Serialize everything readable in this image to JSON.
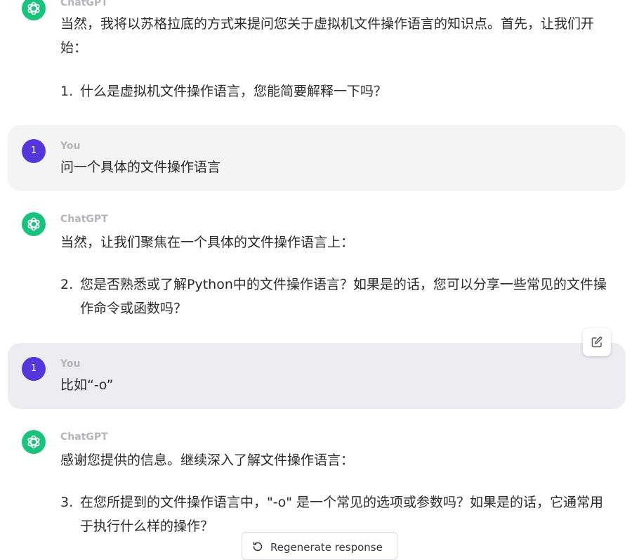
{
  "conversation": {
    "msg1": {
      "author": "ChatGPT",
      "text": "当然，我将以苏格拉底的方式来提问您关于虚拟机文件操作语言的知识点。首先，让我们开始：",
      "item_num": "1.",
      "item_text": "什么是虚拟机文件操作语言，您能简要解释一下吗？"
    },
    "msg2": {
      "author": "You",
      "avatar_letter": "1",
      "text": "问一个具体的文件操作语言"
    },
    "msg3": {
      "author": "ChatGPT",
      "text": "当然，让我们聚焦在一个具体的文件操作语言上：",
      "item_num": "2.",
      "item_text": "您是否熟悉或了解Python中的文件操作语言？如果是的话，您可以分享一些常见的文件操作命令或函数吗？"
    },
    "msg4": {
      "author": "You",
      "avatar_letter": "1",
      "text": "比如“-o”"
    },
    "msg5": {
      "author": "ChatGPT",
      "text": "感谢您提供的信息。继续深入了解文件操作语言：",
      "item_num": "3.",
      "item_text": "在您所提到的文件操作语言中，\"-o\" 是一个常见的选项或参数吗？如果是的话，它通常用于执行什么样的操作？"
    }
  },
  "actions": {
    "regenerate_label": "Regenerate response",
    "edit_icon": "edit-icon",
    "regenerate_icon": "refresh-icon"
  },
  "colors": {
    "gpt_avatar": "#19c37d",
    "user_avatar": "#5436da",
    "user_bubble": "#f4f4f5",
    "user_bubble_active": "#ececf1",
    "author_label": "#b4b4bc",
    "body_text": "#2b2b2b"
  }
}
